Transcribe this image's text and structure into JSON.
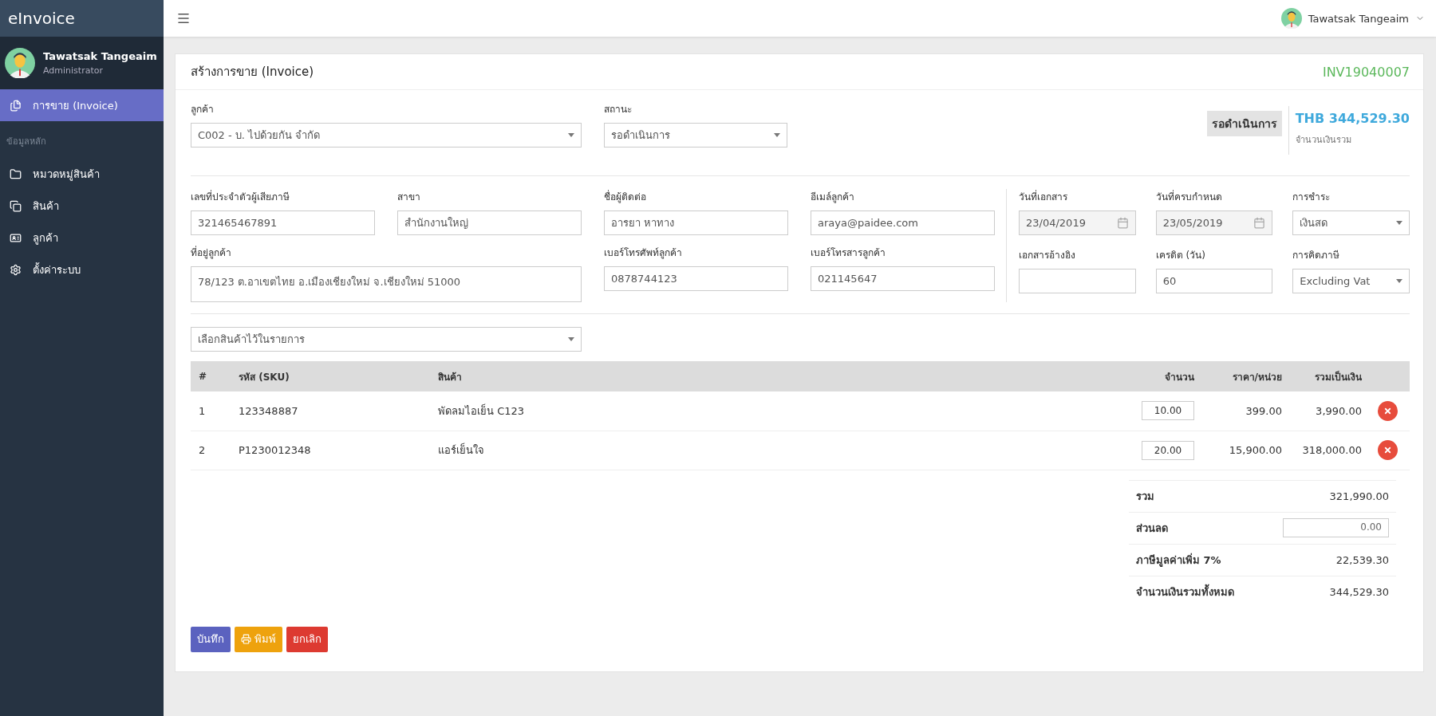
{
  "app": {
    "brand": "eInvoice"
  },
  "user": {
    "name": "Tawatsak Tangeaim",
    "role": "Administrator"
  },
  "topbar": {
    "user_name": "Tawatsak Tangeaim"
  },
  "sidebar": {
    "items": [
      {
        "kind": "link",
        "label": "การขาย (Invoice)",
        "selected": true
      },
      {
        "kind": "heading",
        "label": "ข้อมูลหลัก"
      },
      {
        "kind": "link",
        "label": "หมวดหมู่สินค้า",
        "selected": false
      },
      {
        "kind": "link",
        "label": "สินค้า",
        "selected": false
      },
      {
        "kind": "link",
        "label": "ลูกค้า",
        "selected": false
      },
      {
        "kind": "link",
        "label": "ตั้งค่าระบบ",
        "selected": false
      }
    ]
  },
  "page": {
    "title": "สร้างการขาย (Invoice)",
    "doc_number": "INV19040007",
    "customer": {
      "label": "ลูกค้า",
      "value": "C002 - บ. ไปด้วยกัน จำกัด"
    },
    "status": {
      "label": "สถานะ",
      "value": "รอดำเนินการ"
    },
    "status_badge": "รอดำเนินการ",
    "total_amount": "THB 344,529.30",
    "total_caption": "จำนวนเงินรวม"
  },
  "details_left": [
    {
      "kind": "text",
      "label": "เลขที่ประจำตัวผู้เสียภาษี",
      "value": "321465467891"
    },
    {
      "kind": "text",
      "label": "สาขา",
      "value": "สำนักงานใหญ่"
    },
    {
      "kind": "text",
      "label": "ชื่อผู้ติดต่อ",
      "value": "อารยา หาทาง"
    },
    {
      "kind": "text",
      "label": "อีเมล์ลูกค้า",
      "value": "araya@paidee.com"
    },
    {
      "kind": "textarea",
      "label": "ที่อยู่ลูกค้า",
      "value": "78/123 ต.อาเขตไทย อ.เมืองเชียงใหม่ จ.เชียงใหม่ 51000"
    },
    {
      "kind": "text",
      "label": "เบอร์โทรศัพท์ลูกค้า",
      "value": "0878744123"
    },
    {
      "kind": "text",
      "label": "เบอร์โทรสารลูกค้า",
      "value": "021145647"
    }
  ],
  "details_right": [
    {
      "kind": "date",
      "label": "วันที่เอกสาร",
      "value": "23/04/2019"
    },
    {
      "kind": "date",
      "label": "วันที่ครบกำหนด",
      "value": "23/05/2019"
    },
    {
      "kind": "select",
      "label": "การชำระ",
      "value": "เงินสด"
    },
    {
      "kind": "text",
      "label": "เอกสารอ้างอิง"
    },
    {
      "kind": "text",
      "label": "เครดิต (วัน)",
      "value": "60"
    },
    {
      "kind": "select",
      "label": "การคิดภาษี",
      "value": "Excluding Vat"
    }
  ],
  "product_picker": {
    "placeholder": "เลือกสินค้าไว้ในรายการ"
  },
  "table": {
    "columns": [
      {
        "kind": "text",
        "label": "#"
      },
      {
        "kind": "text",
        "label": "รหัส (SKU)"
      },
      {
        "kind": "text",
        "label": "สินค้า"
      },
      {
        "kind": "number",
        "label": "จำนวน"
      },
      {
        "kind": "number",
        "label": "ราคา/หน่วย"
      },
      {
        "kind": "number",
        "label": "รวมเป็นเงิน"
      }
    ],
    "rows": [
      {
        "no": "1",
        "sku": "123348887",
        "product": "พัดลมไอเย็น C123",
        "qty": "10.00",
        "price": "399.00",
        "amount": "3,990.00"
      },
      {
        "no": "2",
        "sku": "P1230012348",
        "product": "แอร์เย็นใจ",
        "qty": "20.00",
        "price": "15,900.00",
        "amount": "318,000.00"
      }
    ]
  },
  "totals": [
    {
      "kind": "value",
      "label": "รวม",
      "value": "321,990.00"
    },
    {
      "kind": "input",
      "label": "ส่วนลด",
      "value": "0.00"
    },
    {
      "kind": "value",
      "label": "ภาษีมูลค่าเพิ่ม 7%",
      "value": "22,539.30"
    },
    {
      "kind": "value",
      "label": "จำนวนเงินรวมทั้งหมด",
      "value": "344,529.30"
    }
  ],
  "buttons": [
    {
      "kind": "save",
      "label": "บันทึก"
    },
    {
      "kind": "print",
      "label": "พิมพ์"
    },
    {
      "kind": "cancel",
      "label": "ยกเลิก"
    }
  ]
}
